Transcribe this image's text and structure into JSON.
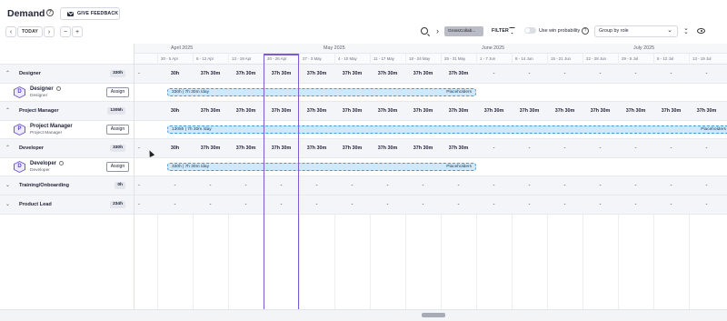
{
  "header": {
    "title": "Demand",
    "feedback_label": "GIVE FEEDBACK",
    "today_label": "TODAY",
    "prev_icon": "chevron-left-icon",
    "next_icon": "chevron-right-icon",
    "zoom_out": "−",
    "zoom_in": "+",
    "chip_label": "GrossCollab...",
    "filter_label": "FILTER",
    "win_probability_label": "Use win probability",
    "group_by_label": "Group by role",
    "accent_color": "#7d5bd6"
  },
  "timeline": {
    "months": [
      "April 2025",
      "May 2025",
      "June 2025",
      "July 2025"
    ],
    "weeks": [
      "30 - 5 Apr",
      "6 - 12 Apr",
      "13 - 19 Apr",
      "20 - 26 Apr",
      "27 - 3 May",
      "4 - 10 May",
      "11 - 17 May",
      "18 - 24 May",
      "25 - 31 May",
      "1 - 7 Jun",
      "8 - 14 Jun",
      "15 - 21 Jun",
      "22 - 28 Jun",
      "29 - 5 Jul",
      "6 - 12 Jul",
      "13 - 19 Jul"
    ],
    "current_week": "20 - 26 Apr"
  },
  "rows": {
    "designer": {
      "label": "Designer",
      "badge": "330h",
      "first": "-",
      "cells": [
        "30h",
        "37h 30m",
        "37h 30m",
        "37h 30m",
        "37h 30m",
        "37h 30m",
        "37h 30m",
        "37h 30m",
        "37h 30m",
        "-",
        "-",
        "-",
        "-",
        "-",
        "-",
        "-"
      ]
    },
    "designer_person": {
      "initial": "D",
      "name": "Designer",
      "role": "Designer",
      "assign_label": "Assign",
      "bar_label": "330h | 7h 30m /day",
      "bar_right": "Placeholders"
    },
    "pm": {
      "label": "Project Manager",
      "badge": "1305h",
      "first": "",
      "cells": [
        "30h",
        "37h 30m",
        "37h 30m",
        "37h 30m",
        "37h 30m",
        "37h 30m",
        "37h 30m",
        "37h 30m",
        "37h 30m",
        "37h 30m",
        "37h 30m",
        "37h 30m",
        "37h 30m",
        "37h 30m",
        "37h 30m",
        "37h 30m"
      ]
    },
    "pm_person": {
      "initial": "P",
      "name": "Project Manager",
      "role": "Project Manager",
      "assign_label": "Assign",
      "bar_label": "1305h | 7h 30m /day",
      "bar_right": "Placeholders"
    },
    "developer": {
      "label": "Developer",
      "badge": "330h",
      "first": "-",
      "cells": [
        "30h",
        "37h 30m",
        "37h 30m",
        "37h 30m",
        "37h 30m",
        "37h 30m",
        "37h 30m",
        "37h 30m",
        "37h 30m",
        "-",
        "-",
        "-",
        "-",
        "-",
        "-",
        "-"
      ]
    },
    "developer_person": {
      "initial": "D",
      "name": "Developer",
      "role": "Developer",
      "assign_label": "Assign",
      "bar_label": "330h | 7h 30m /day",
      "bar_right": "Placeholders"
    },
    "training": {
      "label": "Training/Onboarding",
      "badge": "0h",
      "first": "-",
      "cells": [
        "-",
        "-",
        "-",
        "-",
        "-",
        "-",
        "-",
        "-",
        "-",
        "-",
        "-",
        "-",
        "-",
        "-",
        "-",
        "-"
      ]
    },
    "product_lead": {
      "label": "Product Lead",
      "badge": "234h",
      "first": "-",
      "cells": [
        "-",
        "-",
        "-",
        "-",
        "-",
        "-",
        "-",
        "-",
        "-",
        "-",
        "-",
        "-",
        "-",
        "-",
        "-",
        "-"
      ]
    }
  }
}
